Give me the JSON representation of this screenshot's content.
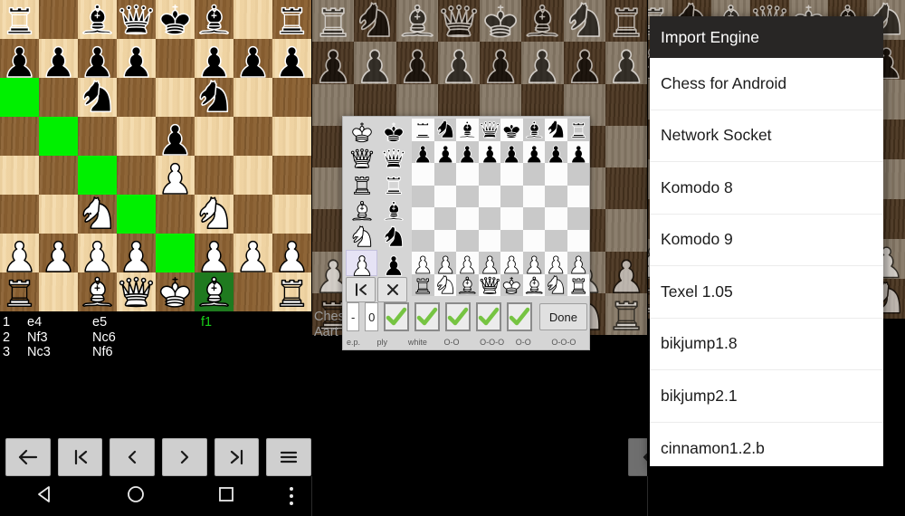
{
  "import_dialog": {
    "title": "Import Engine",
    "engines": [
      "Chess for Android",
      "Network Socket",
      "Komodo 8",
      "Komodo 9",
      "Texel 1.05",
      "bikjump1.8",
      "bikjump2.1",
      "cinnamon1.2.b"
    ]
  },
  "panel1": {
    "moves": [
      {
        "num": "1",
        "white": "e4",
        "black": "e5"
      },
      {
        "num": "2",
        "white": "Nf3",
        "black": "Nc6"
      },
      {
        "num": "3",
        "white": "Nc3",
        "black": "Nf6"
      }
    ],
    "current_square": "f1",
    "board": {
      "rows": [
        [
          "br",
          "",
          "bb",
          "bq",
          "bk",
          "bb",
          "",
          "br"
        ],
        [
          "bp",
          "bp",
          "bp",
          "bp",
          "",
          "bp",
          "bp",
          "bp"
        ],
        [
          "",
          "",
          "bn",
          "",
          "",
          "bn",
          "",
          ""
        ],
        [
          "",
          "",
          "",
          "",
          "bp",
          "",
          "",
          ""
        ],
        [
          "",
          "",
          "",
          "",
          "wp",
          "",
          "",
          ""
        ],
        [
          "",
          "",
          "wn",
          "",
          "",
          "wn",
          "",
          ""
        ],
        [
          "wp",
          "wp",
          "wp",
          "wp",
          "",
          "wp",
          "wp",
          "wp"
        ],
        [
          "wr",
          "",
          "wb",
          "wq",
          "wk",
          "wb",
          "",
          "wr"
        ]
      ],
      "highlights": [
        "a6",
        "b5",
        "c4",
        "d3",
        "e2"
      ],
      "selected": "f1"
    }
  },
  "panel2": {
    "app_name_line1": "Ches",
    "app_name_line2": "Aart J",
    "edit_dialog": {
      "palette_selected": "white-pawn",
      "reset_button": "|<",
      "clear_button": "X",
      "ep_value": "-",
      "ply_value": "0",
      "done_label": "Done",
      "labels": [
        "e.p.",
        "ply",
        "white",
        "O-O",
        "O-O-O",
        "O-O",
        "O-O-O"
      ],
      "checkboxes": [
        true,
        true,
        true,
        true,
        true
      ],
      "board_rows": [
        [
          "br",
          "bn",
          "bb",
          "bq",
          "bk",
          "bb",
          "bn",
          "br"
        ],
        [
          "bp",
          "bp",
          "bp",
          "bp",
          "bp",
          "bp",
          "bp",
          "bp"
        ],
        [
          "",
          "",
          "",
          "",
          "",
          "",
          "",
          ""
        ],
        [
          "",
          "",
          "",
          "",
          "",
          "",
          "",
          ""
        ],
        [
          "",
          "",
          "",
          "",
          "",
          "",
          "",
          ""
        ],
        [
          "",
          "",
          "",
          "",
          "",
          "",
          "",
          ""
        ],
        [
          "wp",
          "wp",
          "wp",
          "wp",
          "wp",
          "wp",
          "wp",
          "wp"
        ],
        [
          "wr",
          "wn",
          "wb",
          "wq",
          "wk",
          "wb",
          "wn",
          "wr"
        ]
      ]
    },
    "board": {
      "rows": [
        [
          "br",
          "bn",
          "bb",
          "bq",
          "bk",
          "bb",
          "bn",
          "br"
        ],
        [
          "bp",
          "bp",
          "bp",
          "bp",
          "bp",
          "bp",
          "bp",
          "bp"
        ],
        [
          "",
          "",
          "",
          "",
          "",
          "",
          "",
          ""
        ],
        [
          "",
          "",
          "",
          "",
          "",
          "",
          "",
          ""
        ],
        [
          "",
          "",
          "",
          "",
          "",
          "",
          "",
          ""
        ],
        [
          "",
          "",
          "",
          "",
          "",
          "",
          "",
          ""
        ],
        [
          "wp",
          "wp",
          "wp",
          "wp",
          "wp",
          "wp",
          "wp",
          "wp"
        ],
        [
          "wr",
          "wn",
          "wb",
          "wq",
          "wk",
          "wb",
          "wn",
          "wr"
        ]
      ]
    }
  },
  "panel3": {
    "board": {
      "rows": [
        [
          "br",
          "bn",
          "bb",
          "bq",
          "bk",
          "bb",
          "bn",
          "br"
        ],
        [
          "bp",
          "bp",
          "bp",
          "bp",
          "bp",
          "bp",
          "bp",
          "bp"
        ],
        [
          "",
          "",
          "",
          "",
          "",
          "",
          "",
          ""
        ],
        [
          "",
          "",
          "",
          "",
          "",
          "",
          "",
          ""
        ],
        [
          "",
          "",
          "",
          "",
          "",
          "",
          "",
          ""
        ],
        [
          "",
          "",
          "",
          "",
          "",
          "",
          "",
          ""
        ],
        [
          "wp",
          "wp",
          "wp",
          "wp",
          "wp",
          "wp",
          "wp",
          "wp"
        ],
        [
          "wr",
          "wn",
          "wb",
          "wq",
          "wk",
          "wb",
          "wn",
          "wr"
        ]
      ]
    }
  },
  "toolbar": {
    "buttons": [
      "back-arrow",
      "first-move",
      "previous-move",
      "next-move",
      "last-move",
      "menu"
    ]
  },
  "navbar": {
    "buttons": [
      "back",
      "home",
      "recents",
      "overflow"
    ]
  },
  "colors": {
    "light_square": "#f3d9a9",
    "dark_square": "#8a6031",
    "highlight": "#00f000",
    "selected": "#1f7a1f",
    "current_move_text": "#18d018",
    "dialog_bg": "#ffffff",
    "dialog_title_bg": "#181614"
  }
}
